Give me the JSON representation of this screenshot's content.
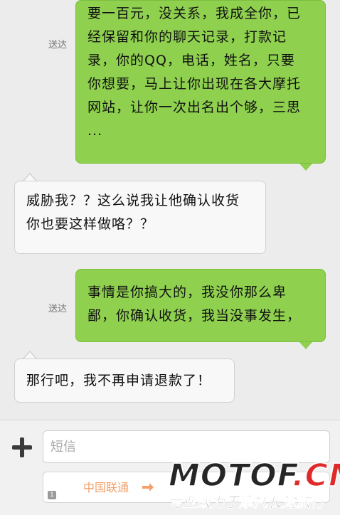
{
  "messages": [
    {
      "direction": "out",
      "status": "送达",
      "text": "要一百元，没关系，我成全你，已\n经保留和你的聊天记录，打款记\n录，你的QQ，电话，姓名，只要\n你想要，马上让你出现在各大摩托\n网站，让你一次出名出个够，三思\n..."
    },
    {
      "direction": "in",
      "text": "威胁我？？这么说我让他确认收货\n你也要这样做咯？？"
    },
    {
      "direction": "out",
      "status": "送达",
      "text": "事情是你搞大的，我没你那么卑\n鄙，你确认收货，我当没事发生，"
    },
    {
      "direction": "in",
      "text": "那行吧，我不再申请退款了！"
    }
  ],
  "input_bar": {
    "placeholder": "短信",
    "sim_slot": "1",
    "carrier": "中国联通"
  },
  "watermark": {
    "logo_main": "MOTOF",
    "logo_suffix": ".CN",
    "tagline": "专业致力于摩托长途旅行",
    "colors": {
      "main": "#262626",
      "accent": "#e02a2a"
    }
  },
  "colors": {
    "sent_bubble": "#8fd14f",
    "received_bubble": "#f8f8f8",
    "background": "#ececec"
  }
}
